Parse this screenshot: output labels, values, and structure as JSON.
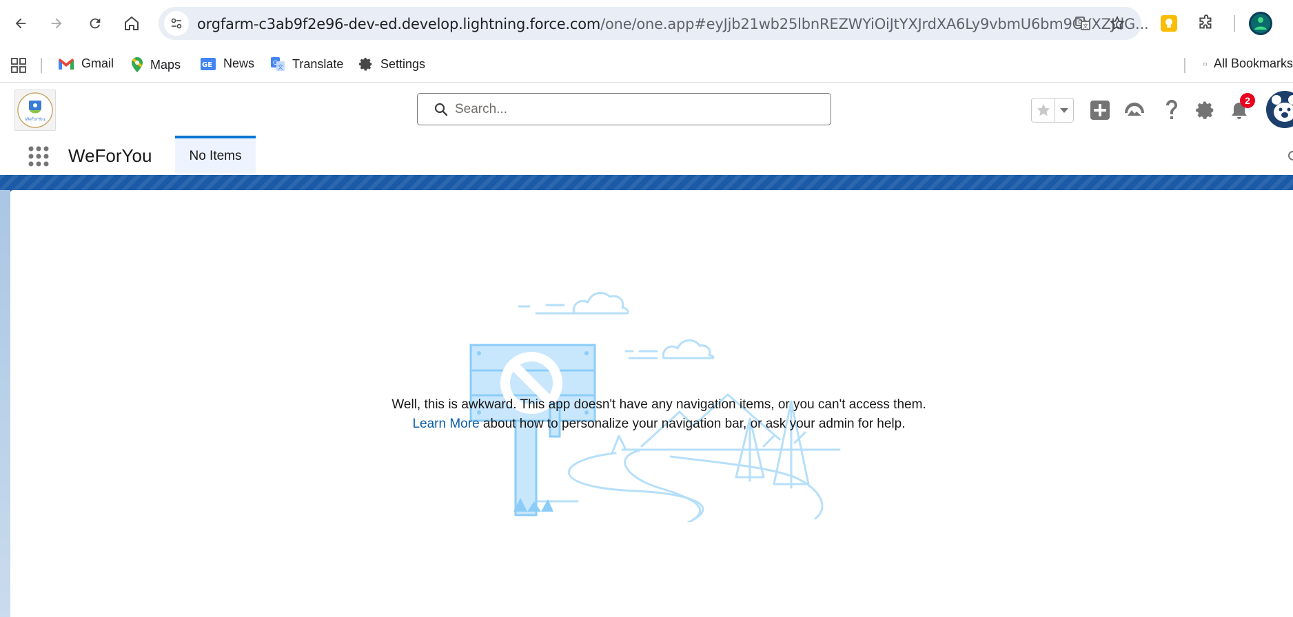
{
  "browser": {
    "url_host": "orgfarm-c3ab9f2e96-dev-ed.develop.lightning.force.com",
    "url_path": "/one/one.app#eyJjb21wb25lbnREZWYiOiJtYXJrdXA6Ly9vbmU6bm9OYXZJdG..."
  },
  "bookmarks": {
    "items": [
      {
        "label": "Gmail",
        "icon": "gmail-icon"
      },
      {
        "label": "Maps",
        "icon": "maps-icon"
      },
      {
        "label": "News",
        "icon": "news-icon"
      },
      {
        "label": "Translate",
        "icon": "translate-icon"
      },
      {
        "label": "Settings",
        "icon": "gear-icon"
      }
    ],
    "all_bookmarks": "All Bookmarks"
  },
  "salesforce": {
    "search_placeholder": "Search...",
    "notification_count": "2",
    "app_name": "WeForYou",
    "logo_text": "WeForYou",
    "nav_tab": "No Items"
  },
  "empty_state": {
    "message": "Well, this is awkward. This app doesn't have any navigation items, or you can't access them.",
    "link_text": "Learn More",
    "link_suffix": " about how to personalize your navigation bar, or ask your admin for help."
  },
  "colors": {
    "brand_blue": "#0176d3",
    "band_blue": "#1b5aa6",
    "badge_red": "#ea001e",
    "illustration_blue": "#b6dffa"
  }
}
